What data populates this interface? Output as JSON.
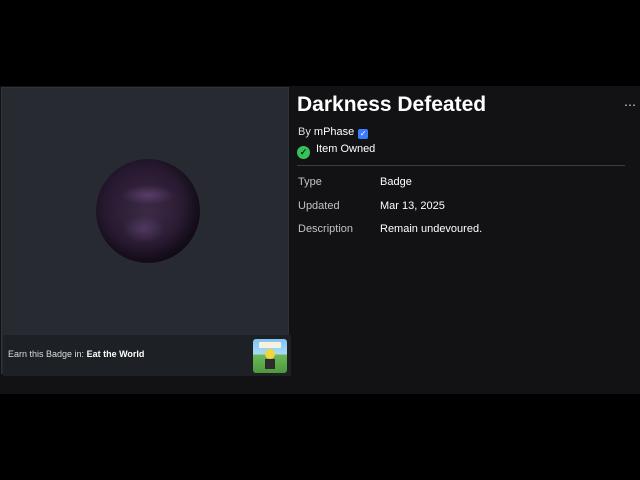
{
  "badge": {
    "title": "Darkness Defeated",
    "by_prefix": "By",
    "creator": "mPhase",
    "owned_label": "Item Owned",
    "more_icon": "⋯"
  },
  "details": [
    {
      "key": "Type",
      "value": "Badge"
    },
    {
      "key": "Updated",
      "value": "Mar 13, 2025"
    },
    {
      "key": "Description",
      "value": "Remain undevoured."
    }
  ],
  "earn": {
    "prefix": "Earn this Badge in:",
    "game": "Eat the World"
  },
  "colors": {
    "verified": "#3b7cff",
    "owned": "#37c257",
    "panel": "#272b31",
    "page": "#121215"
  }
}
